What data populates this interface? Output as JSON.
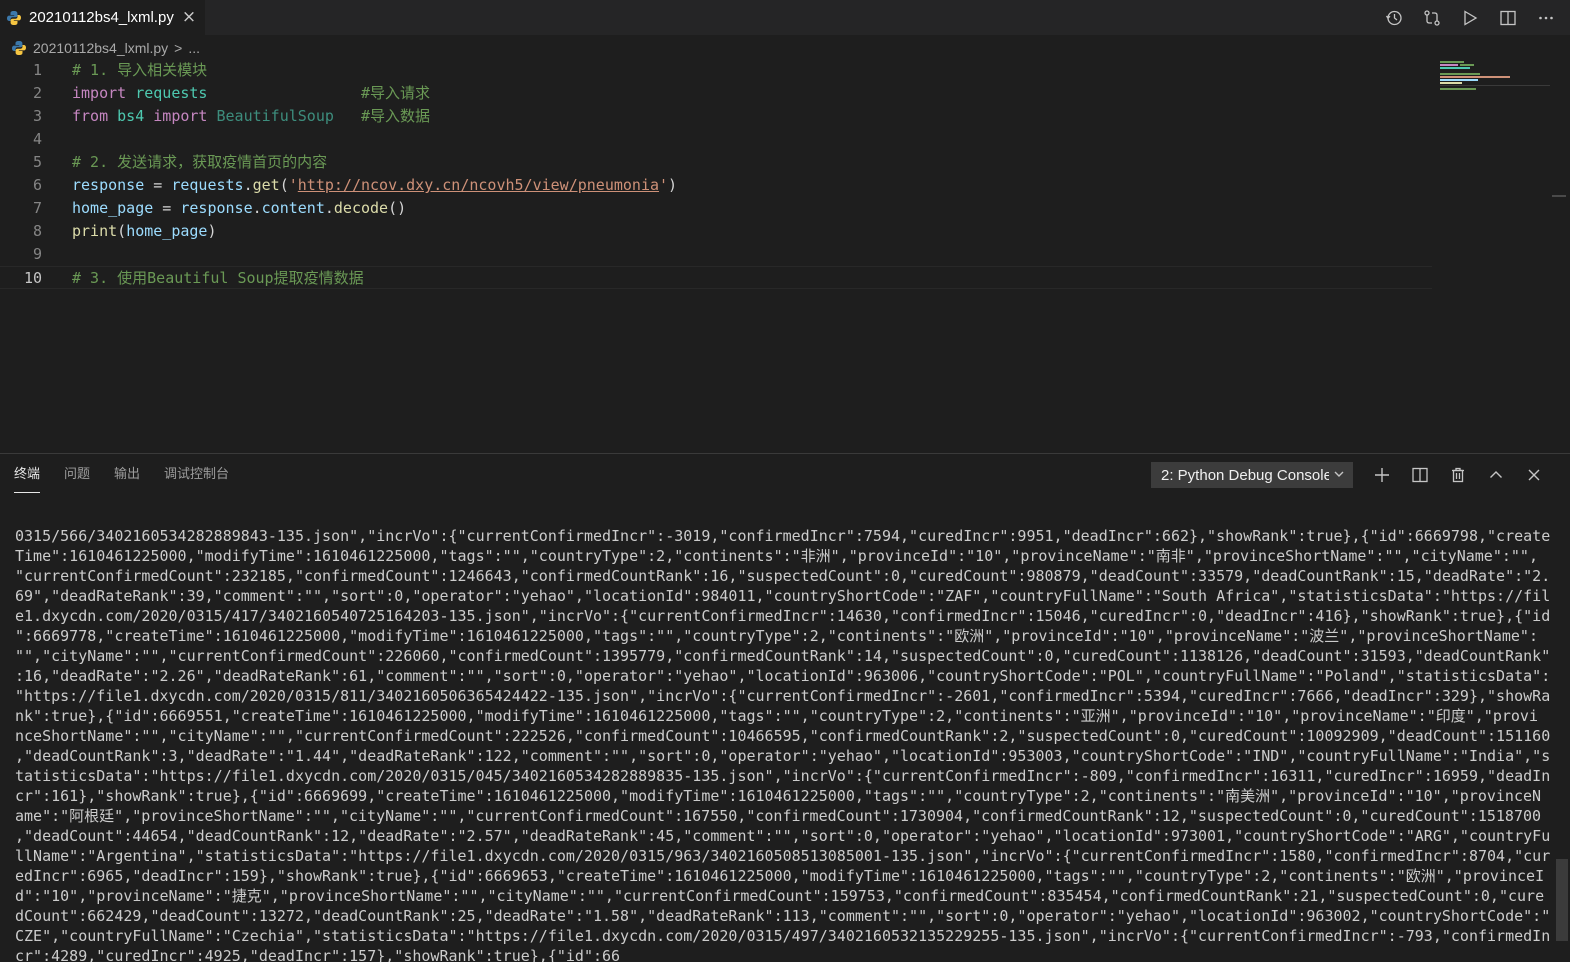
{
  "tab": {
    "title": "20210112bs4_lxml.py",
    "close_icon": "×"
  },
  "actions": [
    "history-icon",
    "compare-changes-icon",
    "run-icon",
    "split-editor-icon",
    "more-icon"
  ],
  "breadcrumb": {
    "file": "20210112bs4_lxml.py",
    "separator": ">",
    "more": "..."
  },
  "editor": {
    "active_line": 10,
    "lines": [
      {
        "n": "1",
        "tokens": [
          [
            "comment",
            "# 1. 导入相关模块"
          ]
        ]
      },
      {
        "n": "2",
        "tokens": [
          [
            "kw",
            "import"
          ],
          [
            "plain",
            " "
          ],
          [
            "mod",
            "requests"
          ],
          [
            "plain",
            "                 "
          ],
          [
            "comment",
            "#导入请求"
          ]
        ]
      },
      {
        "n": "3",
        "tokens": [
          [
            "kw",
            "from"
          ],
          [
            "plain",
            " "
          ],
          [
            "mod",
            "bs4"
          ],
          [
            "plain",
            " "
          ],
          [
            "kw",
            "import"
          ],
          [
            "plain",
            " "
          ],
          [
            "class",
            "BeautifulSoup"
          ],
          [
            "plain",
            "   "
          ],
          [
            "comment",
            "#导入数据"
          ]
        ]
      },
      {
        "n": "4",
        "tokens": []
      },
      {
        "n": "5",
        "tokens": [
          [
            "comment",
            "# 2. 发送请求，获取疫情首页的内容"
          ]
        ]
      },
      {
        "n": "6",
        "tokens": [
          [
            "var",
            "response"
          ],
          [
            "plain",
            " = "
          ],
          [
            "var",
            "requests"
          ],
          [
            "plain",
            "."
          ],
          [
            "fn",
            "get"
          ],
          [
            "plain",
            "("
          ],
          [
            "str",
            "'"
          ],
          [
            "url",
            "http://ncov.dxy.cn/ncovh5/view/pneumonia"
          ],
          [
            "str",
            "'"
          ],
          [
            "plain",
            ")"
          ]
        ]
      },
      {
        "n": "7",
        "tokens": [
          [
            "var",
            "home_page"
          ],
          [
            "plain",
            " = "
          ],
          [
            "var",
            "response"
          ],
          [
            "plain",
            "."
          ],
          [
            "var",
            "content"
          ],
          [
            "plain",
            "."
          ],
          [
            "fn",
            "decode"
          ],
          [
            "plain",
            "()"
          ]
        ]
      },
      {
        "n": "8",
        "tokens": [
          [
            "fn",
            "print"
          ],
          [
            "plain",
            "("
          ],
          [
            "var",
            "home_page"
          ],
          [
            "plain",
            ")"
          ]
        ]
      },
      {
        "n": "9",
        "tokens": []
      },
      {
        "n": "10",
        "tokens": [
          [
            "comment",
            "# 3. 使用Beautiful Soup提取疫情数据"
          ]
        ]
      }
    ]
  },
  "panel": {
    "tabs": [
      "终端",
      "问题",
      "输出",
      "调试控制台"
    ],
    "active_tab": 0,
    "terminal_select": "2: Python Debug Console",
    "actions": [
      "add-terminal-icon",
      "split-terminal-icon",
      "trash-icon",
      "maximize-panel-icon",
      "close-panel-icon"
    ]
  },
  "terminal": {
    "lines": [
      "0315/566/3402160534282889843-135.json\",\"incrVo\":{\"currentConfirmedIncr\":-3019,\"confirmedIncr\":7594,\"curedIncr\":9951,\"deadIncr\":662},\"showRank\":true},{\"id\":6669798,\"create",
      "Time\":1610461225000,\"modifyTime\":1610461225000,\"tags\":\"\",\"countryType\":2,\"continents\":\"非洲\",\"provinceId\":\"10\",\"provinceName\":\"南非\",\"provinceShortName\":\"\",\"cityName\":\"\",",
      "\"currentConfirmedCount\":232185,\"confirmedCount\":1246643,\"confirmedCountRank\":16,\"suspectedCount\":0,\"curedCount\":980879,\"deadCount\":33579,\"deadCountRank\":15,\"deadRate\":\"2.",
      "69\",\"deadRateRank\":39,\"comment\":\"\",\"sort\":0,\"operator\":\"yehao\",\"locationId\":984011,\"countryShortCode\":\"ZAF\",\"countryFullName\":\"South Africa\",\"statisticsData\":\"https://fil",
      "e1.dxycdn.com/2020/0315/417/3402160540725164203-135.json\",\"incrVo\":{\"currentConfirmedIncr\":14630,\"confirmedIncr\":15046,\"curedIncr\":0,\"deadIncr\":416},\"showRank\":true},{\"id",
      "\":6669778,\"createTime\":1610461225000,\"modifyTime\":1610461225000,\"tags\":\"\",\"countryType\":2,\"continents\":\"欧洲\",\"provinceId\":\"10\",\"provinceName\":\"波兰\",\"provinceShortName\":",
      "\"\",\"cityName\":\"\",\"currentConfirmedCount\":226060,\"confirmedCount\":1395779,\"confirmedCountRank\":14,\"suspectedCount\":0,\"curedCount\":1138126,\"deadCount\":31593,\"deadCountRank\"",
      ":16,\"deadRate\":\"2.26\",\"deadRateRank\":61,\"comment\":\"\",\"sort\":0,\"operator\":\"yehao\",\"locationId\":963006,\"countryShortCode\":\"POL\",\"countryFullName\":\"Poland\",\"statisticsData\":",
      "\"https://file1.dxycdn.com/2020/0315/811/3402160506365424422-135.json\",\"incrVo\":{\"currentConfirmedIncr\":-2601,\"confirmedIncr\":5394,\"curedIncr\":7666,\"deadIncr\":329},\"showRa",
      "nk\":true},{\"id\":6669551,\"createTime\":1610461225000,\"modifyTime\":1610461225000,\"tags\":\"\",\"countryType\":2,\"continents\":\"亚洲\",\"provinceId\":\"10\",\"provinceName\":\"印度\",\"provi",
      "nceShortName\":\"\",\"cityName\":\"\",\"currentConfirmedCount\":222526,\"confirmedCount\":10466595,\"confirmedCountRank\":2,\"suspectedCount\":0,\"curedCount\":10092909,\"deadCount\":151160",
      ",\"deadCountRank\":3,\"deadRate\":\"1.44\",\"deadRateRank\":122,\"comment\":\"\",\"sort\":0,\"operator\":\"yehao\",\"locationId\":953003,\"countryShortCode\":\"IND\",\"countryFullName\":\"India\",\"s",
      "tatisticsData\":\"https://file1.dxycdn.com/2020/0315/045/3402160534282889835-135.json\",\"incrVo\":{\"currentConfirmedIncr\":-809,\"confirmedIncr\":16311,\"curedIncr\":16959,\"deadIn",
      "cr\":161},\"showRank\":true},{\"id\":6669699,\"createTime\":1610461225000,\"modifyTime\":1610461225000,\"tags\":\"\",\"countryType\":2,\"continents\":\"南美洲\",\"provinceId\":\"10\",\"provinceN",
      "ame\":\"阿根廷\",\"provinceShortName\":\"\",\"cityName\":\"\",\"currentConfirmedCount\":167550,\"confirmedCount\":1730904,\"confirmedCountRank\":12,\"suspectedCount\":0,\"curedCount\":1518700",
      ",\"deadCount\":44654,\"deadCountRank\":12,\"deadRate\":\"2.57\",\"deadRateRank\":45,\"comment\":\"\",\"sort\":0,\"operator\":\"yehao\",\"locationId\":973001,\"countryShortCode\":\"ARG\",\"countryFu",
      "llName\":\"Argentina\",\"statisticsData\":\"https://file1.dxycdn.com/2020/0315/963/3402160508513085001-135.json\",\"incrVo\":{\"currentConfirmedIncr\":1580,\"confirmedIncr\":8704,\"cur",
      "edIncr\":6965,\"deadIncr\":159},\"showRank\":true},{\"id\":6669653,\"createTime\":1610461225000,\"modifyTime\":1610461225000,\"tags\":\"\",\"countryType\":2,\"continents\":\"欧洲\",\"provinceI",
      "d\":\"10\",\"provinceName\":\"捷克\",\"provinceShortName\":\"\",\"cityName\":\"\",\"currentConfirmedCount\":159753,\"confirmedCount\":835454,\"confirmedCountRank\":21,\"suspectedCount\":0,\"cure",
      "dCount\":662429,\"deadCount\":13272,\"deadCountRank\":25,\"deadRate\":\"1.58\",\"deadRateRank\":113,\"comment\":\"\",\"sort\":0,\"operator\":\"yehao\",\"locationId\":963002,\"countryShortCode\":\"",
      "CZE\",\"countryFullName\":\"Czechia\",\"statisticsData\":\"https://file1.dxycdn.com/2020/0315/497/3402160532135229255-135.json\",\"incrVo\":{\"currentConfirmedIncr\":-793,\"confirmedIn",
      "cr\":4289,\"curedIncr\":4925,\"deadIncr\":157},\"showRank\":true},{\"id\":66"
    ]
  },
  "colors": {
    "background": "#1e1e1e",
    "tabbar": "#252526",
    "comment": "#6a9955",
    "keyword": "#c586c0",
    "module": "#4ec9b0",
    "variable": "#9cdcfe",
    "function": "#dcdcaa",
    "string": "#ce9178"
  }
}
